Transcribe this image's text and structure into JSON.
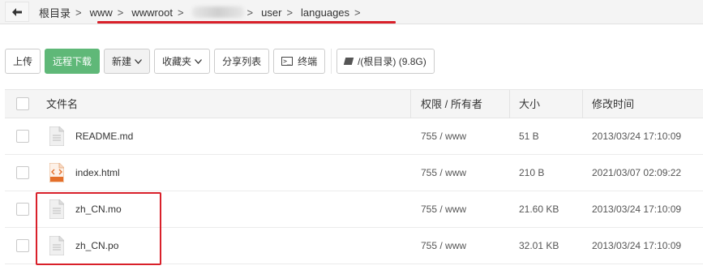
{
  "breadcrumb": {
    "items": [
      "根目录",
      "www",
      "wwwroot",
      "",
      "user",
      "languages"
    ],
    "separator": ">"
  },
  "toolbar": {
    "upload": "上传",
    "remote_download": "远程下载",
    "new": "新建",
    "favorites": "收藏夹",
    "share_list": "分享列表",
    "terminal": "终端",
    "disk": "/(根目录) (9.8G)"
  },
  "table": {
    "headers": {
      "name": "文件名",
      "perm": "权限 / 所有者",
      "size": "大小",
      "mtime": "修改时间"
    },
    "rows": [
      {
        "name": "README.md",
        "perm": "755 / www",
        "size": "51 B",
        "mtime": "2013/03/24 17:10:09",
        "icon": "text-file-icon"
      },
      {
        "name": "index.html",
        "perm": "755 / www",
        "size": "210 B",
        "mtime": "2021/03/07 02:09:22",
        "icon": "html-file-icon"
      },
      {
        "name": "zh_CN.mo",
        "perm": "755 / www",
        "size": "21.60 KB",
        "mtime": "2013/03/24 17:10:09",
        "icon": "text-file-icon"
      },
      {
        "name": "zh_CN.po",
        "perm": "755 / www",
        "size": "32.01 KB",
        "mtime": "2013/03/24 17:10:09",
        "icon": "text-file-icon"
      }
    ]
  },
  "colors": {
    "accent_green": "#5fb878",
    "highlight_red": "#d9202a"
  }
}
